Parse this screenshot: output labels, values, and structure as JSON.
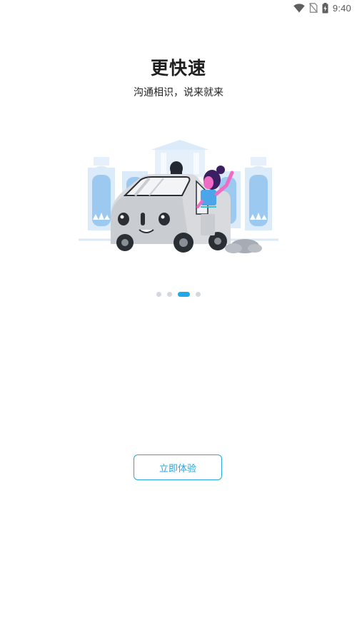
{
  "status_bar": {
    "time": "9:40",
    "icons": [
      "wifi-icon",
      "no-sim-icon",
      "battery-charging-icon"
    ]
  },
  "onboarding": {
    "title": "更快速",
    "subtitle": "沟通相识，说来就来",
    "illustration": "self-driving-car-with-waving-passenger-illustration",
    "pager": {
      "total": 4,
      "active_index": 2
    },
    "cta_label": "立即体验"
  },
  "colors": {
    "accent": "#1fa9e8",
    "dot_inactive": "#d3d8df",
    "title_text": "#1f1f1f"
  }
}
